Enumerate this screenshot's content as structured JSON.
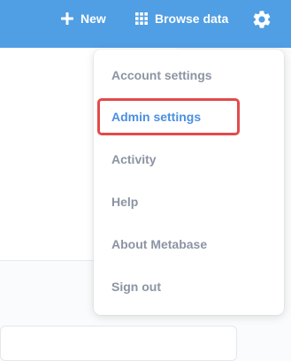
{
  "header": {
    "new_label": "New",
    "browse_label": "Browse data",
    "settings_icon": "gear-icon"
  },
  "menu": {
    "items": [
      {
        "label": "Account settings"
      },
      {
        "label": "Admin settings",
        "highlighted": true
      },
      {
        "label": "Activity"
      },
      {
        "label": "Help"
      },
      {
        "label": "About Metabase"
      },
      {
        "label": "Sign out"
      }
    ]
  },
  "colors": {
    "topbar": "#509ee3",
    "menu_text": "#8c94a3",
    "active_text": "#4a90e2",
    "highlight_border": "#e34a4a"
  }
}
